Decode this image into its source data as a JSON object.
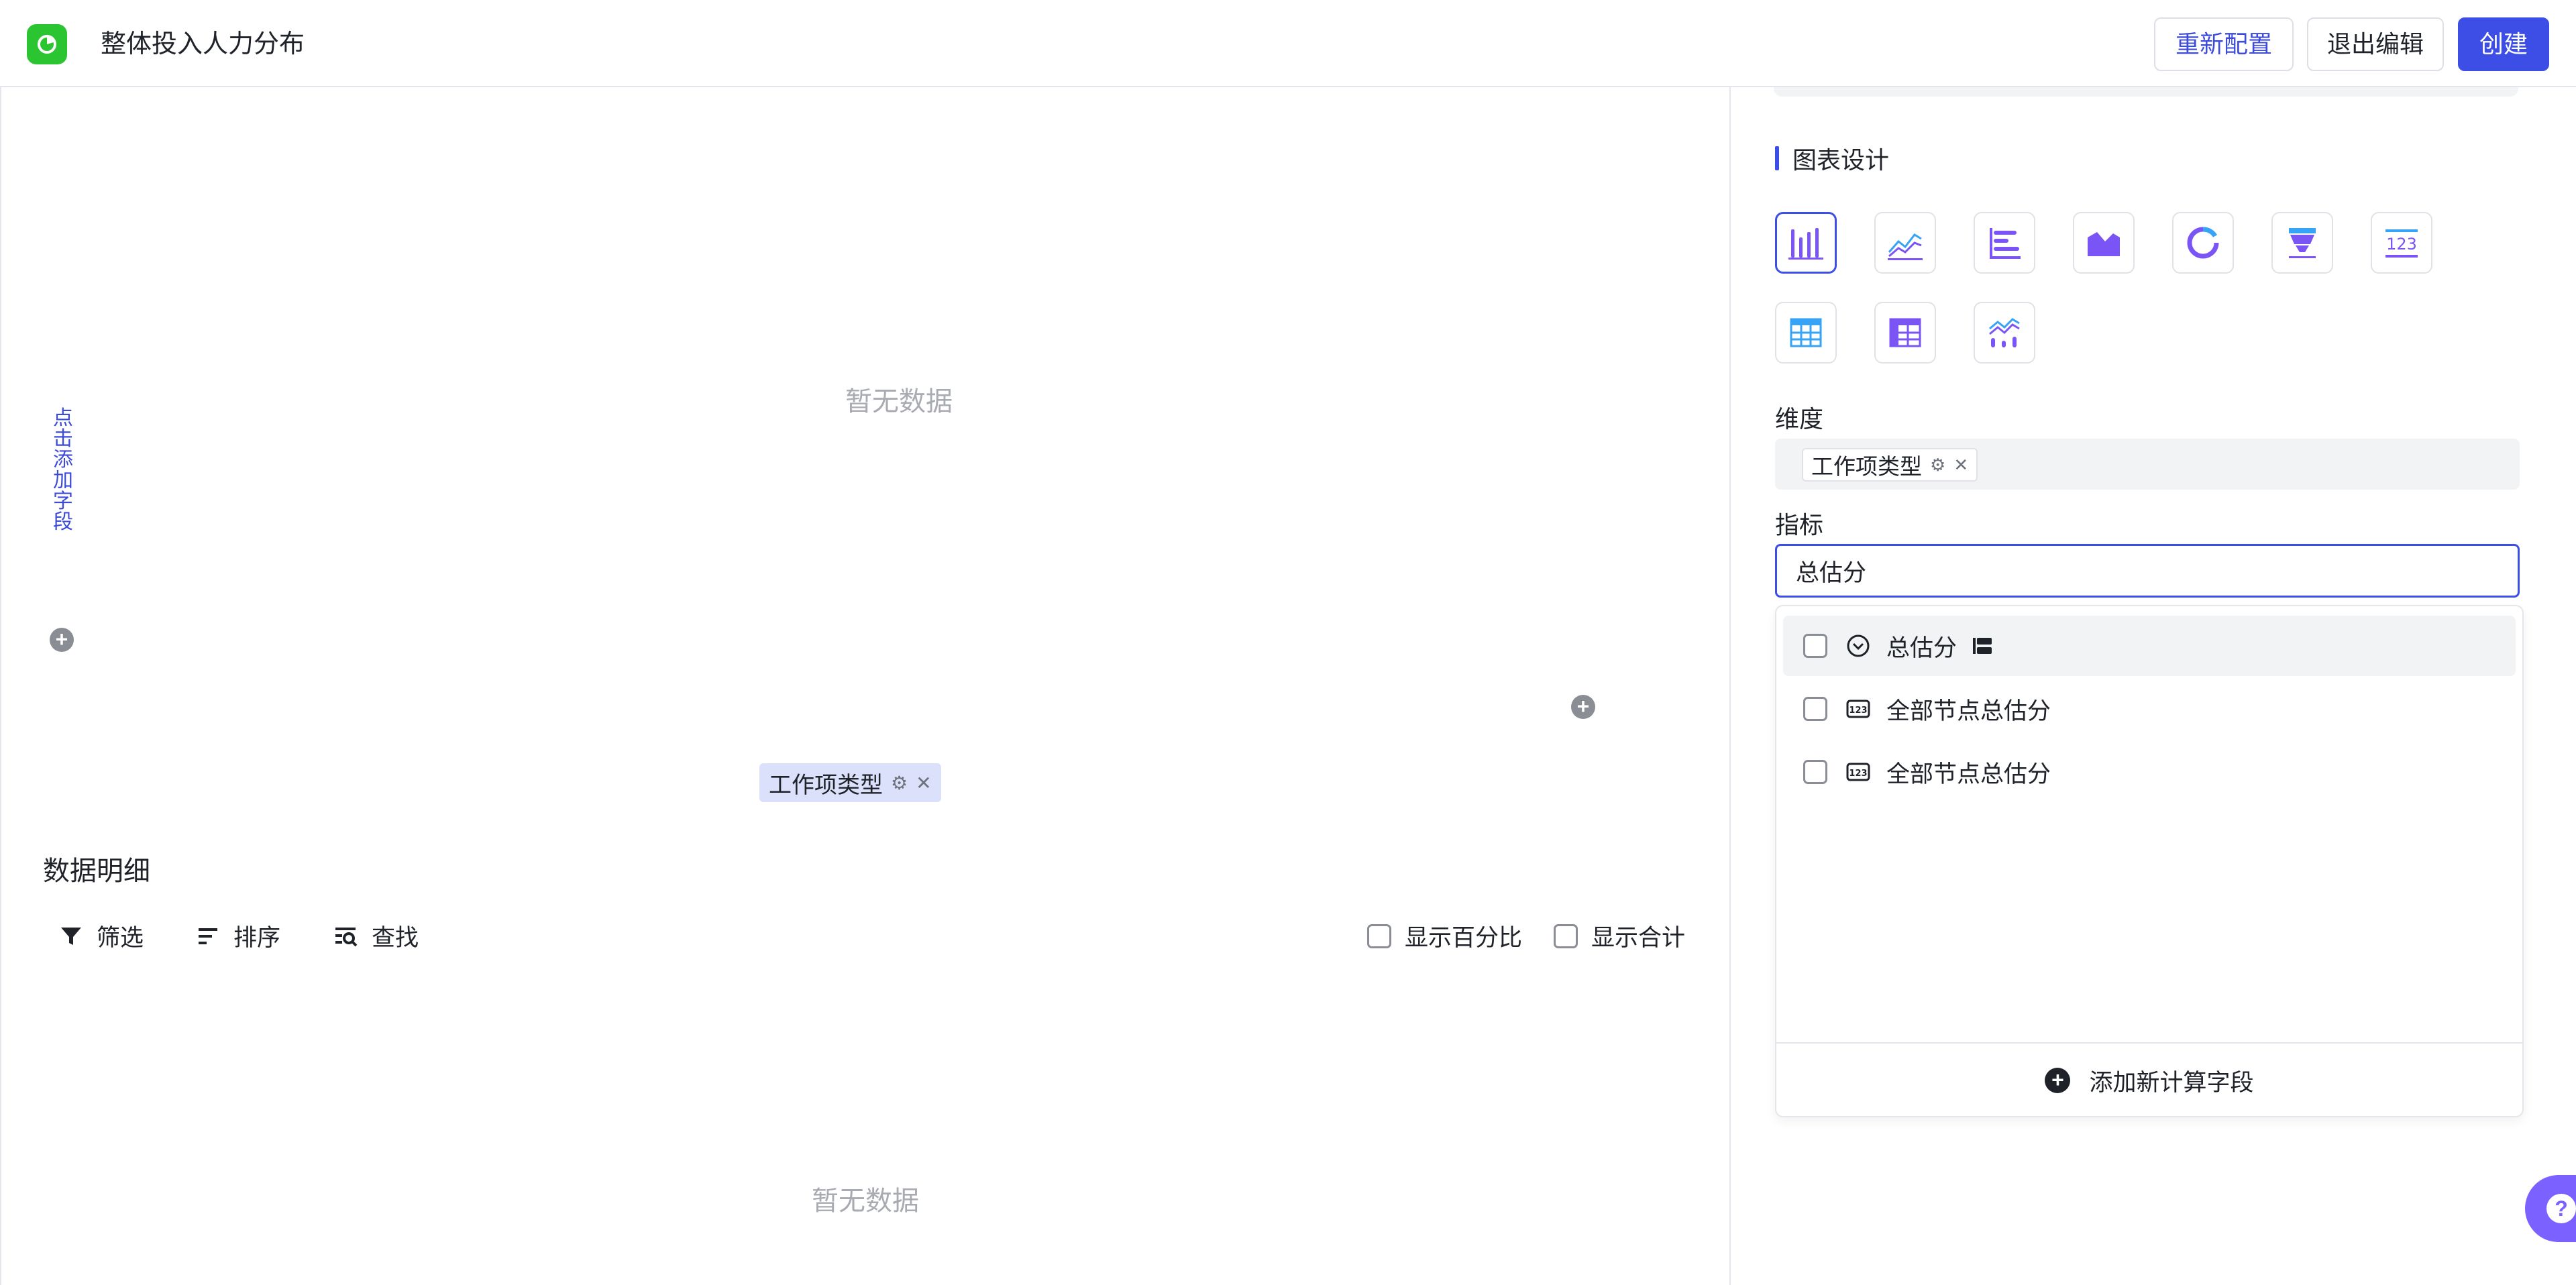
{
  "header": {
    "title": "整体投入人力分布",
    "reconfig_label": "重新配置",
    "exit_label": "退出编辑",
    "create_label": "创建"
  },
  "chart_area": {
    "empty_text": "暂无数据",
    "add_field_label": "点击添加字段",
    "x_field_chip": "工作项类型"
  },
  "detail": {
    "title": "数据明细",
    "filter_label": "筛选",
    "sort_label": "排序",
    "find_label": "查找",
    "show_percent_label": "显示百分比",
    "show_total_label": "显示合计",
    "empty_text": "暂无数据"
  },
  "design": {
    "title": "图表设计",
    "chart_types": [
      {
        "icon": "bar-chart-icon",
        "selected": true
      },
      {
        "icon": "line-chart-icon",
        "selected": false
      },
      {
        "icon": "horizontal-bar-chart-icon",
        "selected": false
      },
      {
        "icon": "area-chart-icon",
        "selected": false
      },
      {
        "icon": "donut-chart-icon",
        "selected": false
      },
      {
        "icon": "funnel-chart-icon",
        "selected": false
      },
      {
        "icon": "number-card-icon",
        "selected": false
      },
      {
        "icon": "table-icon",
        "selected": false
      },
      {
        "icon": "pivot-table-icon",
        "selected": false
      },
      {
        "icon": "combo-chart-icon",
        "selected": false
      }
    ],
    "dimension_label": "维度",
    "dimension_chip": "工作项类型",
    "metric_label": "指标",
    "metric_value": "总估分"
  },
  "dropdown": {
    "options": [
      {
        "label": "总估分",
        "type_icon": "select-field-icon",
        "trail_icon": "group-icon",
        "hover": true
      },
      {
        "label": "全部节点总估分",
        "type_icon": "number-field-icon",
        "hover": false
      },
      {
        "label": "全部节点总估分",
        "type_icon": "number-field-icon",
        "hover": false
      }
    ],
    "footer_label": "添加新计算字段"
  },
  "colors": {
    "accent": "#3c4ee6",
    "logo": "#2cc532",
    "help": "#7b61ff"
  }
}
